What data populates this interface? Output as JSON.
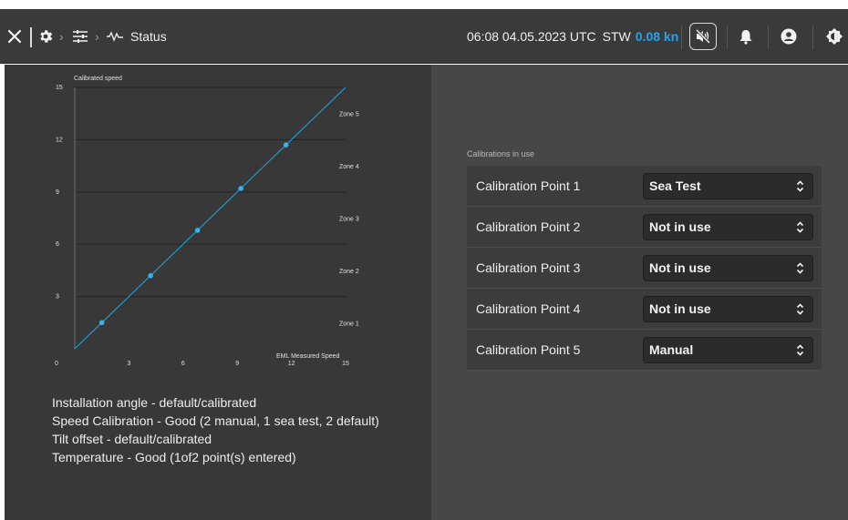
{
  "header": {
    "close_icon": "close-icon",
    "breadcrumb": [
      {
        "icon": "gear-icon"
      },
      {
        "icon": "sliders-icon"
      },
      {
        "icon": "pulse-icon",
        "label": "Status"
      }
    ],
    "datetime": "06:08 04.05.2023 UTC",
    "stw_label": "STW",
    "stw_value": "0.08 kn",
    "icons": [
      "mute-icon",
      "bell-icon",
      "user-icon",
      "brightness-icon"
    ]
  },
  "chart_data": {
    "type": "line",
    "title": "Calibrated speed",
    "xlabel": "EML Measured Speed",
    "ylabel": "Calibrated speed",
    "xlim": [
      0,
      15
    ],
    "ylim": [
      0,
      15
    ],
    "x_ticks": [
      "0",
      "3",
      "6",
      "9",
      "12",
      "15"
    ],
    "y_ticks": [
      "15",
      "12",
      "9",
      "6",
      "3"
    ],
    "zones": [
      "Zone 5",
      "Zone 4",
      "Zone 3",
      "Zone 2",
      "Zone 1"
    ],
    "line": {
      "x": [
        0,
        15
      ],
      "y": [
        0,
        15
      ]
    },
    "points": [
      {
        "x": 1.5,
        "y": 1.5
      },
      {
        "x": 4.2,
        "y": 4.2
      },
      {
        "x": 6.8,
        "y": 6.8
      },
      {
        "x": 9.2,
        "y": 9.2
      },
      {
        "x": 11.7,
        "y": 11.7
      }
    ],
    "grid": true,
    "line_color": "#1f9fd8"
  },
  "status_lines": [
    "Installation angle - default/calibrated",
    "Speed Calibration - Good (2 manual, 1 sea test, 2 default)",
    "Tilt offset - default/calibrated",
    "Temperature - Good (1of2 point(s) entered)"
  ],
  "calibrations": {
    "heading": "Calibrations in use",
    "rows": [
      {
        "label": "Calibration Point 1",
        "value": "Sea Test"
      },
      {
        "label": "Calibration Point 2",
        "value": "Not in use"
      },
      {
        "label": "Calibration Point 3",
        "value": "Not in use"
      },
      {
        "label": "Calibration Point 4",
        "value": "Not in use"
      },
      {
        "label": "Calibration Point 5",
        "value": "Manual"
      }
    ]
  }
}
